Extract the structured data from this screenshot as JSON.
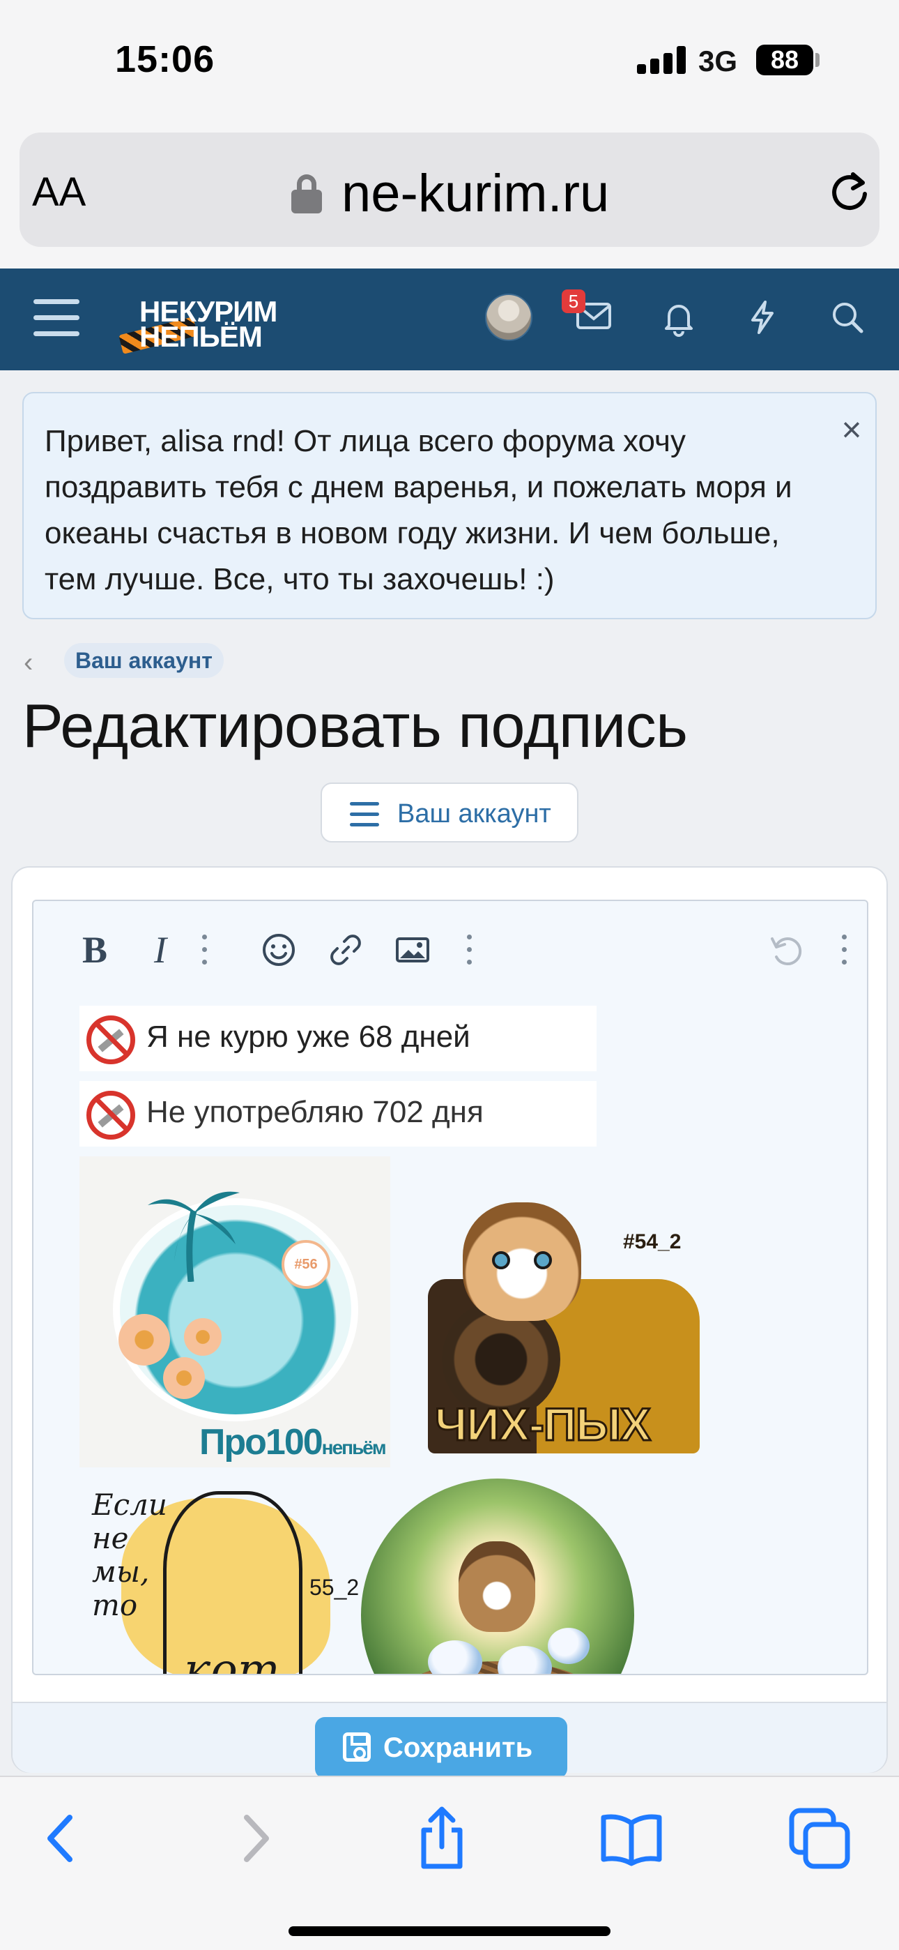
{
  "status_bar": {
    "time": "15:06",
    "network": "3G",
    "battery": "88"
  },
  "browser": {
    "text_size_label": "AA",
    "url": "ne-kurim.ru"
  },
  "header": {
    "logo_line1": "НЕКУРИМ",
    "logo_line2": "НЕПЬЁМ",
    "inbox_badge": "5",
    "icons": [
      "menu-icon",
      "avatar",
      "inbox-icon",
      "bell-icon",
      "lightning-icon",
      "search-icon"
    ],
    "color": "#1c4c72"
  },
  "notice": {
    "text": "Привет, alisa rnd! От лица всего форума хочу поздравить тебя с днем варенья, и пожелать моря и океаны счастья в новом году жизни. И чем больше, тем лучше. Все, что ты захочешь! :)",
    "close": "×"
  },
  "breadcrumb": {
    "back": "‹",
    "label": "Ваш аккаунт"
  },
  "page": {
    "title": "Редактировать подпись",
    "menu_button": "Ваш аккаунт"
  },
  "editor": {
    "toolbar": {
      "bold": "B",
      "italic": "I",
      "icons": [
        "bold-icon",
        "italic-icon",
        "more-vertical-icon",
        "smiley-icon",
        "link-icon",
        "image-icon",
        "more-vertical-icon",
        "undo-icon",
        "more-vertical-icon"
      ]
    },
    "counters": [
      {
        "text": "Я не курю уже 68 дней"
      },
      {
        "text": "Не употребляю 702 дня"
      }
    ],
    "stickers": {
      "beach": {
        "tag": "#56",
        "caption": "Про100",
        "caption_small": "непьём"
      },
      "train": {
        "tag": "#54_2",
        "caption": "ЧИХ-ПЫХ"
      },
      "cat": {
        "text": "Если не мы, то",
        "number": "55_2",
        "bottom": "кот"
      },
      "nest": {}
    }
  },
  "form": {
    "save_label": "Сохранить"
  },
  "accent": "#4aa7e4"
}
